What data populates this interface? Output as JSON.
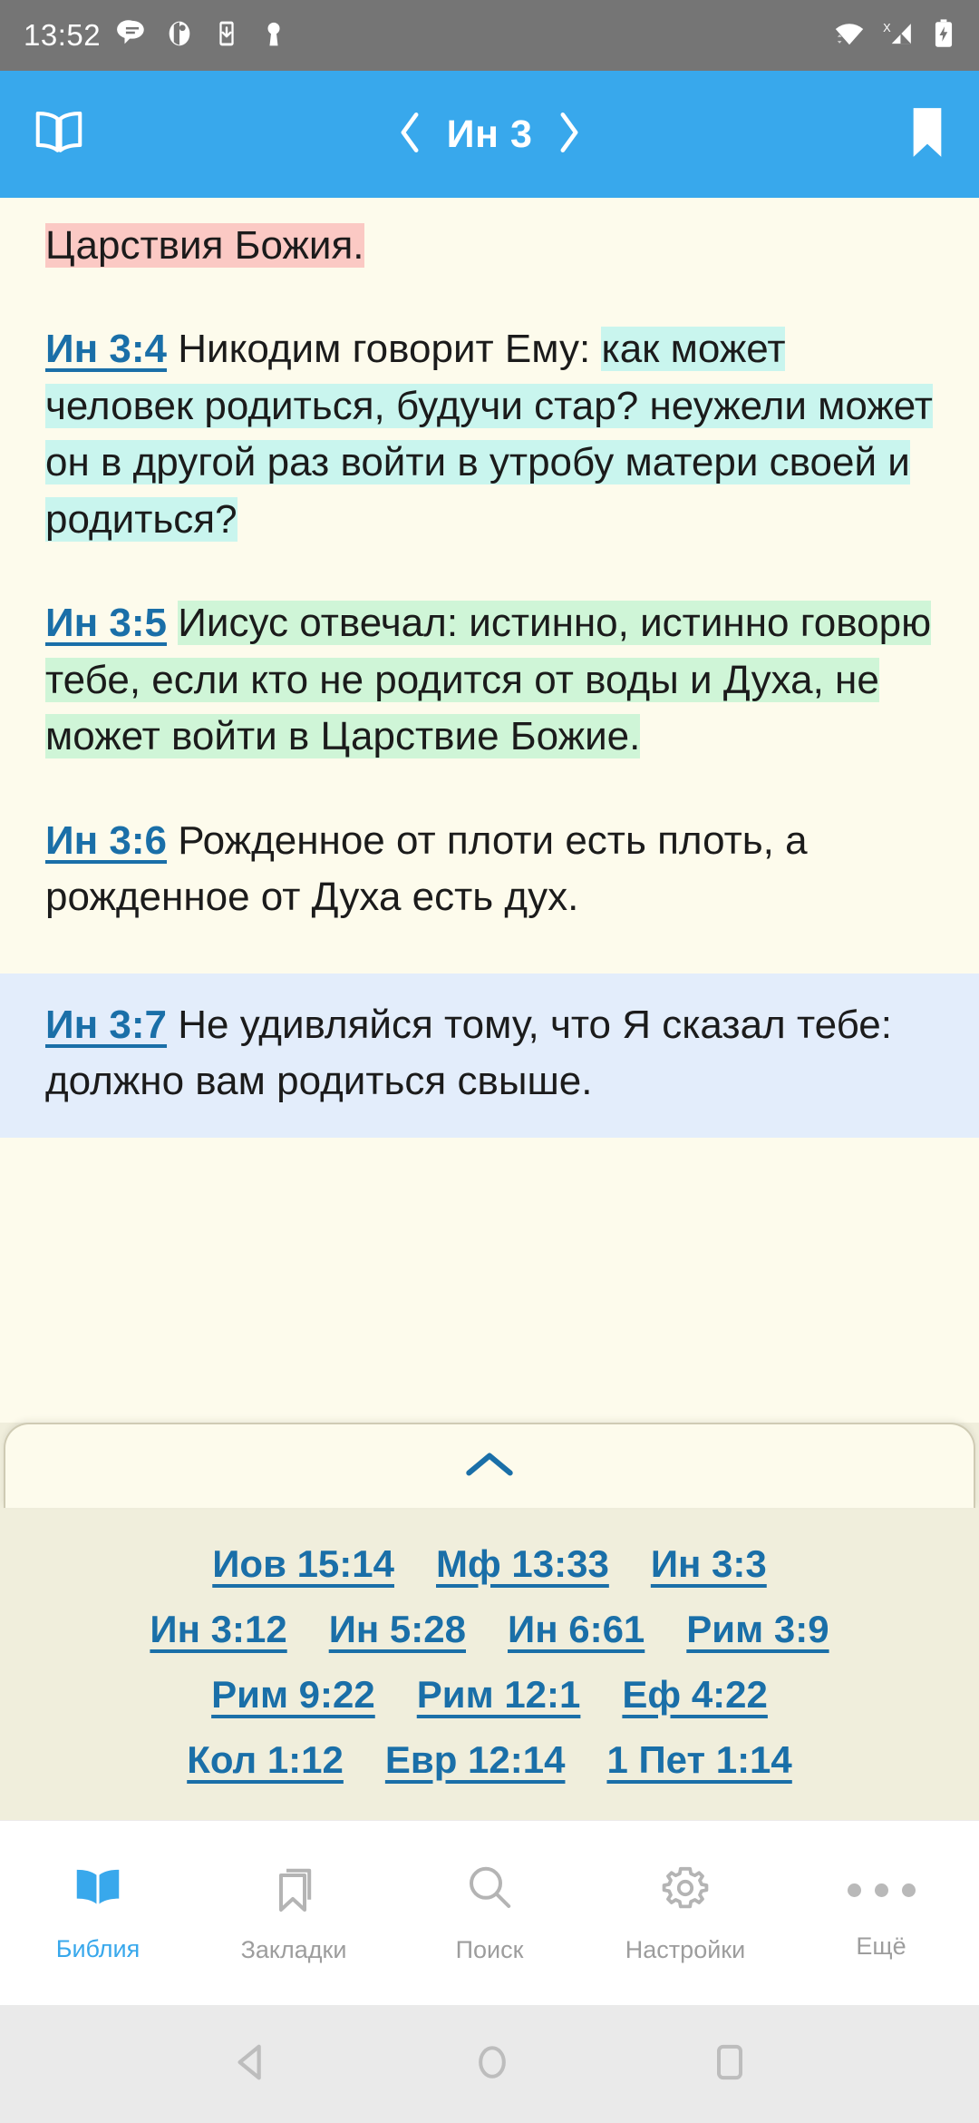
{
  "status_bar": {
    "time": "13:52",
    "left_icons": [
      "message-icon",
      "calendar-icon",
      "download-icon",
      "key-icon"
    ],
    "right_icons": [
      "wifi-icon",
      "cellular-no-sim-icon",
      "battery-charging-icon"
    ]
  },
  "app_bar": {
    "left_icon": "open-book-icon",
    "prev_label": "‹",
    "chapter": "Ин 3",
    "next_label": "›",
    "right_icon": "bookmark-icon",
    "background_color": "#38A8EC"
  },
  "reader": {
    "background_color": "#FDFBEC",
    "highlight_colors": {
      "pink": "#FBC9C4",
      "cyan": "#C9F5EE",
      "green": "#CFF5D7",
      "selection": "#E3EDFB"
    },
    "link_color": "#1A6FA8",
    "verses": [
      {
        "ref": "",
        "partial_tail": true,
        "highlight": "pink",
        "text": "Царствия Божия."
      },
      {
        "ref": "Ин 3:4",
        "highlight": "cyan",
        "lead_plain": "Никодим говорит Ему:",
        "text": "как может человек родиться, будучи стар? неужели может он в другой раз войти в утробу матери своей и родиться?"
      },
      {
        "ref": "Ин 3:5",
        "highlight": "green",
        "lead_plain": "",
        "text": "Иисус отвечал: истинно, истинно говорю тебе, если кто не родится от воды и Духа, не может войти в Царствие Божие."
      },
      {
        "ref": "Ин 3:6",
        "highlight": "none",
        "lead_plain": "",
        "text": "Рожденное от плоти есть плоть, а рожденное от Духа есть дух."
      },
      {
        "ref": "Ин 3:7",
        "highlight": "none",
        "selected": true,
        "lead_plain": "",
        "text": "Не удивляйся тому, что Я сказал тебе: должно вам родиться свыше."
      }
    ]
  },
  "cross_references": {
    "handle_icon": "chevron-up-icon",
    "rows": [
      [
        "Иов 15:14",
        "Мф 13:33",
        "Ин 3:3"
      ],
      [
        "Ин 3:12",
        "Ин 5:28",
        "Ин 6:61",
        "Рим 3:9"
      ],
      [
        "Рим 9:22",
        "Рим 12:1",
        "Еф 4:22"
      ],
      [
        "Кол 1:12",
        "Евр 12:14",
        "1 Пет 1:14"
      ]
    ]
  },
  "tab_bar": {
    "active_color": "#38A8EC",
    "inactive_color": "#9d9d9d",
    "tabs": [
      {
        "label": "Библия",
        "icon": "open-book-icon",
        "active": true
      },
      {
        "label": "Закладки",
        "icon": "bookmark-icon",
        "active": false
      },
      {
        "label": "Поиск",
        "icon": "search-icon",
        "active": false
      },
      {
        "label": "Настройки",
        "icon": "gear-icon",
        "active": false
      },
      {
        "label": "Ещё",
        "icon": "more-dots-icon",
        "active": false
      }
    ]
  },
  "android_nav": {
    "back_icon": "back-triangle-icon",
    "home_icon": "home-circle-icon",
    "recents_icon": "recents-square-icon"
  }
}
